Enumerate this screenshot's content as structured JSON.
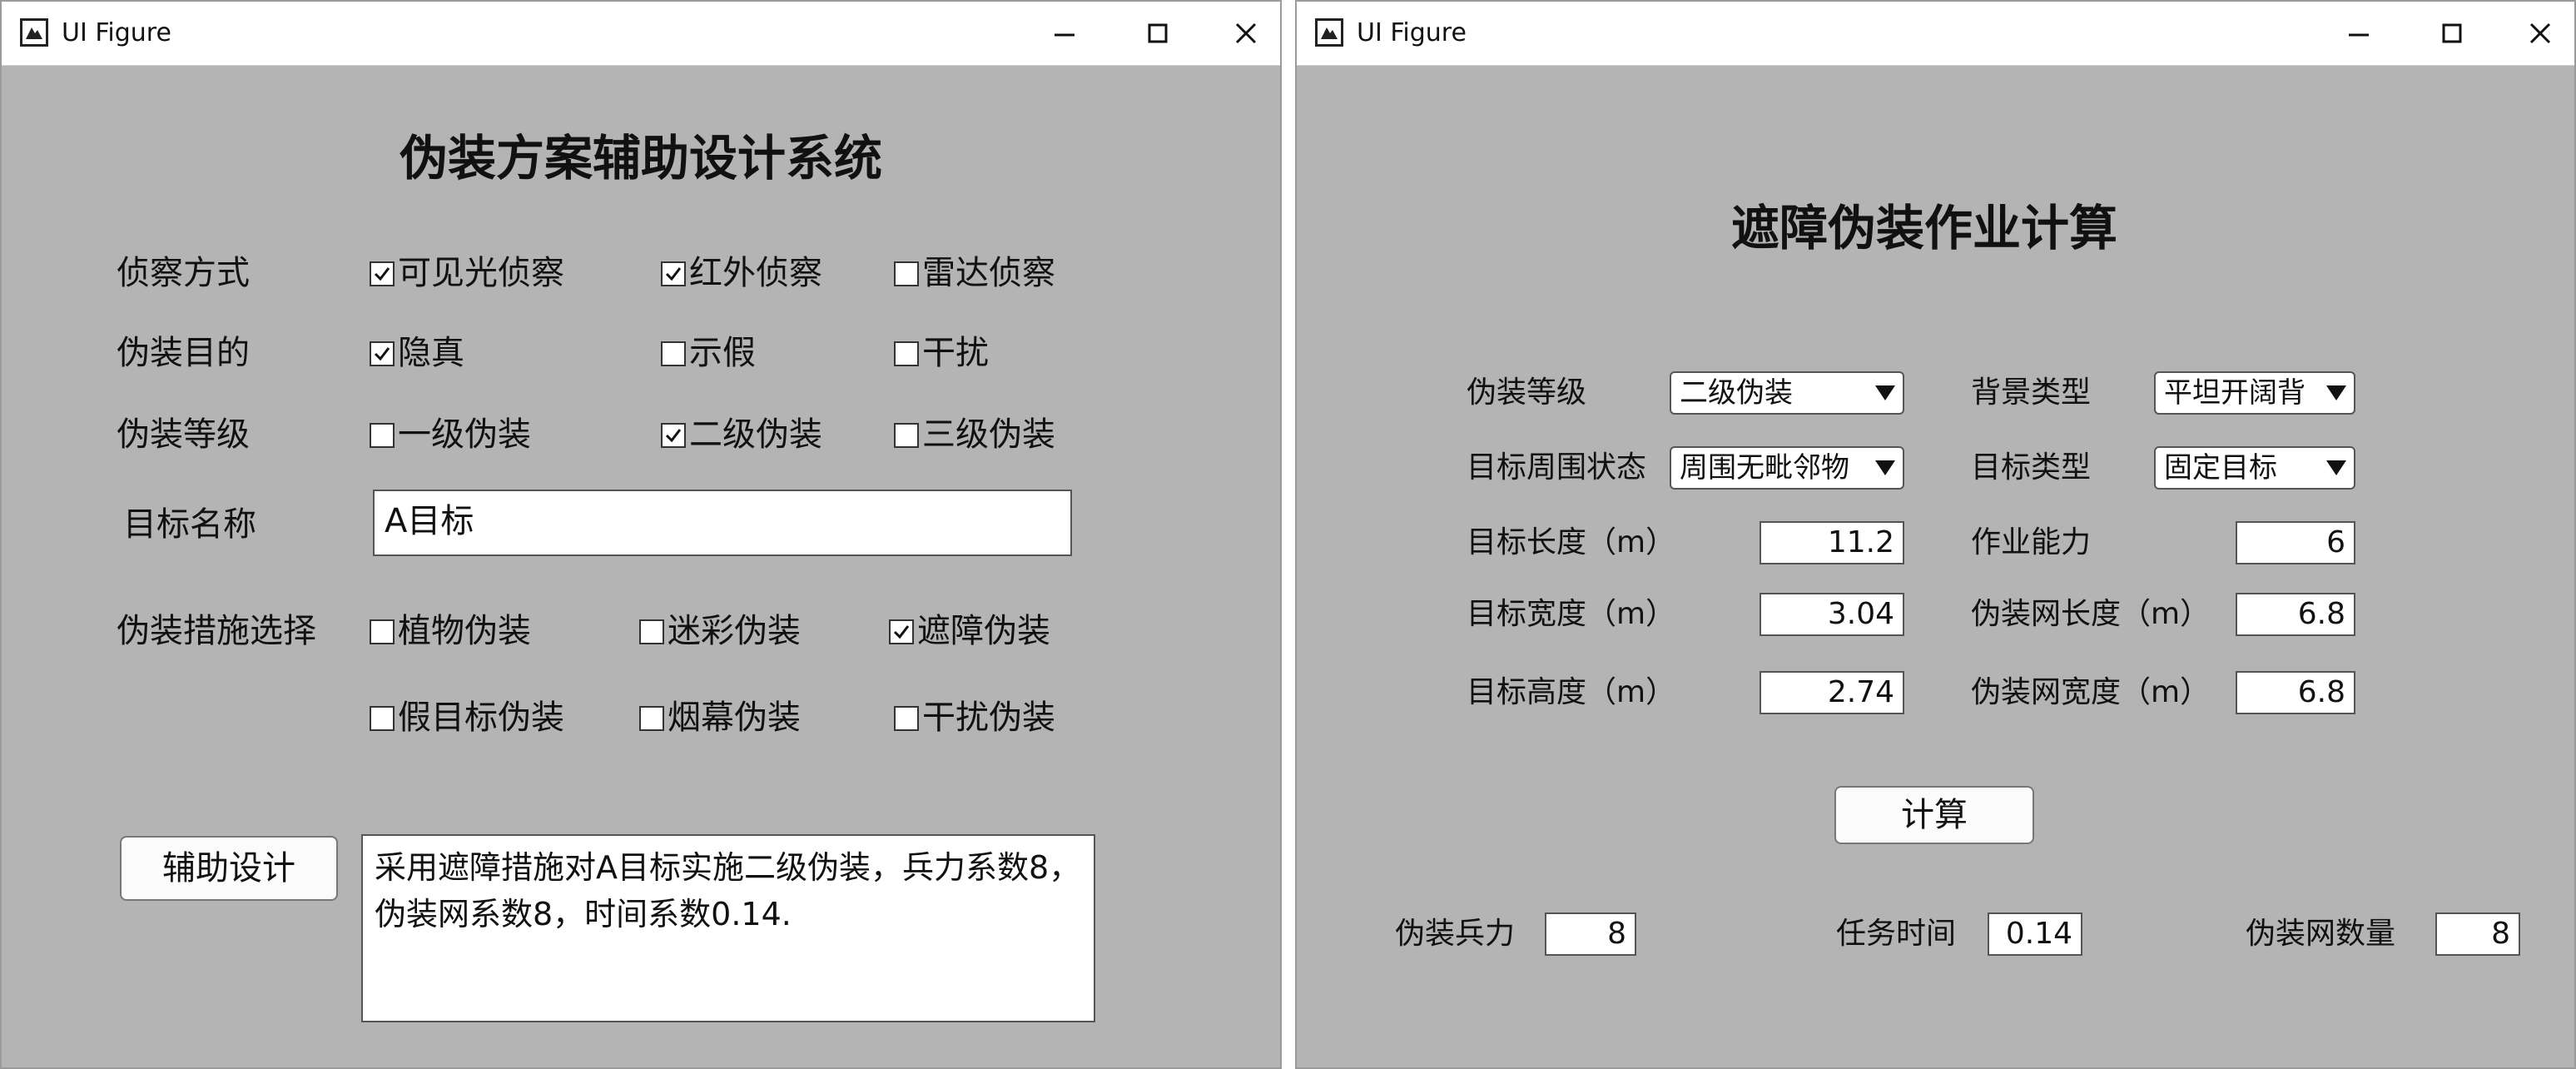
{
  "left_window": {
    "title": "UI Figure",
    "heading": "伪装方案辅助设计系统",
    "rows": [
      {
        "label": "侦察方式",
        "options": [
          {
            "label": "可见光侦察",
            "checked": true
          },
          {
            "label": "红外侦察",
            "checked": true
          },
          {
            "label": "雷达侦察",
            "checked": false
          }
        ]
      },
      {
        "label": "伪装目的",
        "options": [
          {
            "label": "隐真",
            "checked": true
          },
          {
            "label": "示假",
            "checked": false
          },
          {
            "label": "干扰",
            "checked": false
          }
        ]
      },
      {
        "label": "伪装等级",
        "options": [
          {
            "label": "一级伪装",
            "checked": false
          },
          {
            "label": "二级伪装",
            "checked": true
          },
          {
            "label": "三级伪装",
            "checked": false
          }
        ]
      }
    ],
    "target_name_label": "目标名称",
    "target_name_value": "A目标",
    "measures_label": "伪装措施选择",
    "measures": [
      {
        "label": "植物伪装",
        "checked": false
      },
      {
        "label": "迷彩伪装",
        "checked": false
      },
      {
        "label": "遮障伪装",
        "checked": true
      },
      {
        "label": "假目标伪装",
        "checked": false
      },
      {
        "label": "烟幕伪装",
        "checked": false
      },
      {
        "label": "干扰伪装",
        "checked": false
      }
    ],
    "design_button": "辅助设计",
    "result_text": "采用遮障措施对A目标实施二级伪装，兵力系数8，伪装网系数8，时间系数0.14."
  },
  "right_window": {
    "title": "UI Figure",
    "heading": "遮障伪装作业计算",
    "camo_level_label": "伪装等级",
    "camo_level_value": "二级伪装",
    "background_label": "背景类型",
    "background_value": "平坦开阔背",
    "surround_label": "目标周围状态",
    "surround_value": "周围无毗邻物",
    "target_type_label": "目标类型",
    "target_type_value": "固定目标",
    "length_label": "目标长度（m）",
    "length_value": "11.2",
    "capacity_label": "作业能力",
    "capacity_value": "6",
    "width_label": "目标宽度（m）",
    "width_value": "3.04",
    "net_length_label": "伪装网长度（m）",
    "net_length_value": "6.8",
    "height_label": "目标高度（m）",
    "height_value": "2.74",
    "net_width_label": "伪装网宽度（m）",
    "net_width_value": "6.8",
    "calc_button": "计算",
    "troops_label": "伪装兵力",
    "troops_value": "8",
    "time_label": "任务时间",
    "time_value": "0.14",
    "nets_label": "伪装网数量",
    "nets_value": "8"
  },
  "icons": {
    "app": "matlab-figure-icon",
    "minimize": "minimize-icon",
    "maximize": "maximize-icon",
    "close": "close-icon",
    "dropdown": "triangle-down-icon",
    "check": "checkmark-icon"
  }
}
